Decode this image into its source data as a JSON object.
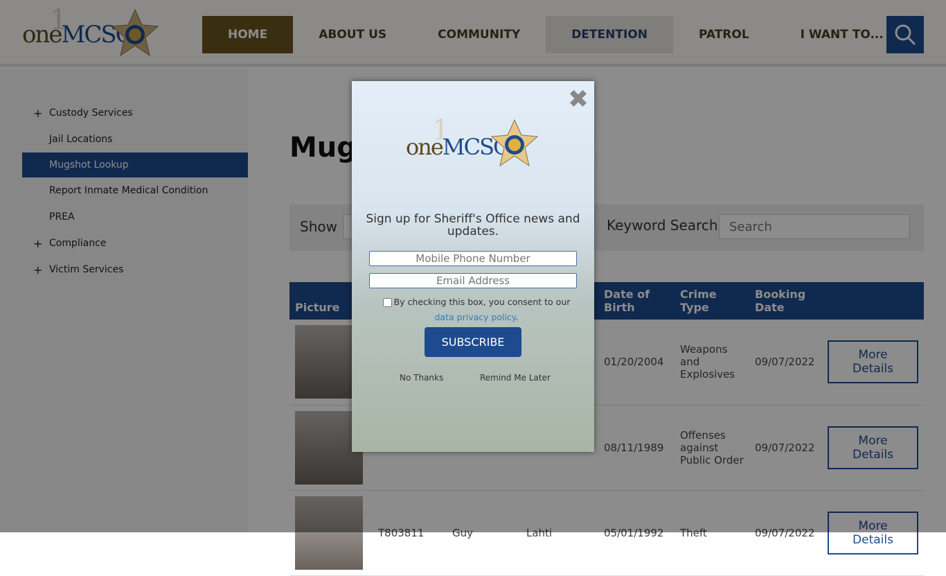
{
  "header": {
    "logo_text_one": "one",
    "logo_text_mcso": "MCSO",
    "nav": [
      "HOME",
      "ABOUT US",
      "COMMUNITY",
      "DETENTION",
      "PATROL",
      "I WANT TO..."
    ]
  },
  "sidebar": {
    "items": [
      {
        "label": "Custody Services",
        "expandable": true
      },
      {
        "label": "Jail Locations"
      },
      {
        "label": "Mugshot Lookup",
        "active": true
      },
      {
        "label": "Report Inmate Medical Condition"
      },
      {
        "label": "PREA"
      },
      {
        "label": "Compliance",
        "expandable": true
      },
      {
        "label": "Victim Services",
        "expandable": true
      }
    ]
  },
  "main": {
    "title": "Mugs",
    "show_label": "Show",
    "keyword_label": "Keyword Search:",
    "search_placeholder": "Search",
    "table": {
      "headers": [
        "Picture",
        "",
        "",
        "",
        "Date of Birth",
        "Crime Type",
        "Booking Date",
        ""
      ],
      "rows": [
        {
          "booking": "",
          "first": "",
          "last": "",
          "dob": "01/20/2004",
          "crime": "Weapons and Explosives",
          "date": "09/07/2022",
          "action": "More Details"
        },
        {
          "booking": "",
          "first": "",
          "last": "",
          "dob": "08/11/1989",
          "crime": "Offenses against Public Order",
          "date": "09/07/2022",
          "action": "More Details"
        },
        {
          "booking": "T803811",
          "first": "Guy",
          "last": "Lahti",
          "dob": "05/01/1992",
          "crime": "Theft",
          "date": "09/07/2022",
          "action": "More Details"
        }
      ]
    }
  },
  "modal": {
    "signup": "Sign up for Sheriff's Office news and updates.",
    "phone_placeholder": "Mobile Phone Number",
    "email_placeholder": "Email Address",
    "consent": "By checking this box, you consent to our ",
    "consent_link": "data privacy policy",
    "consent_end": ".",
    "subscribe": "SUBSCRIBE",
    "no_thanks": "No Thanks",
    "remind": "Remind Me Later"
  },
  "colors": {
    "brand_blue": "#1e4b8f",
    "brand_gold": "#6b5420"
  }
}
